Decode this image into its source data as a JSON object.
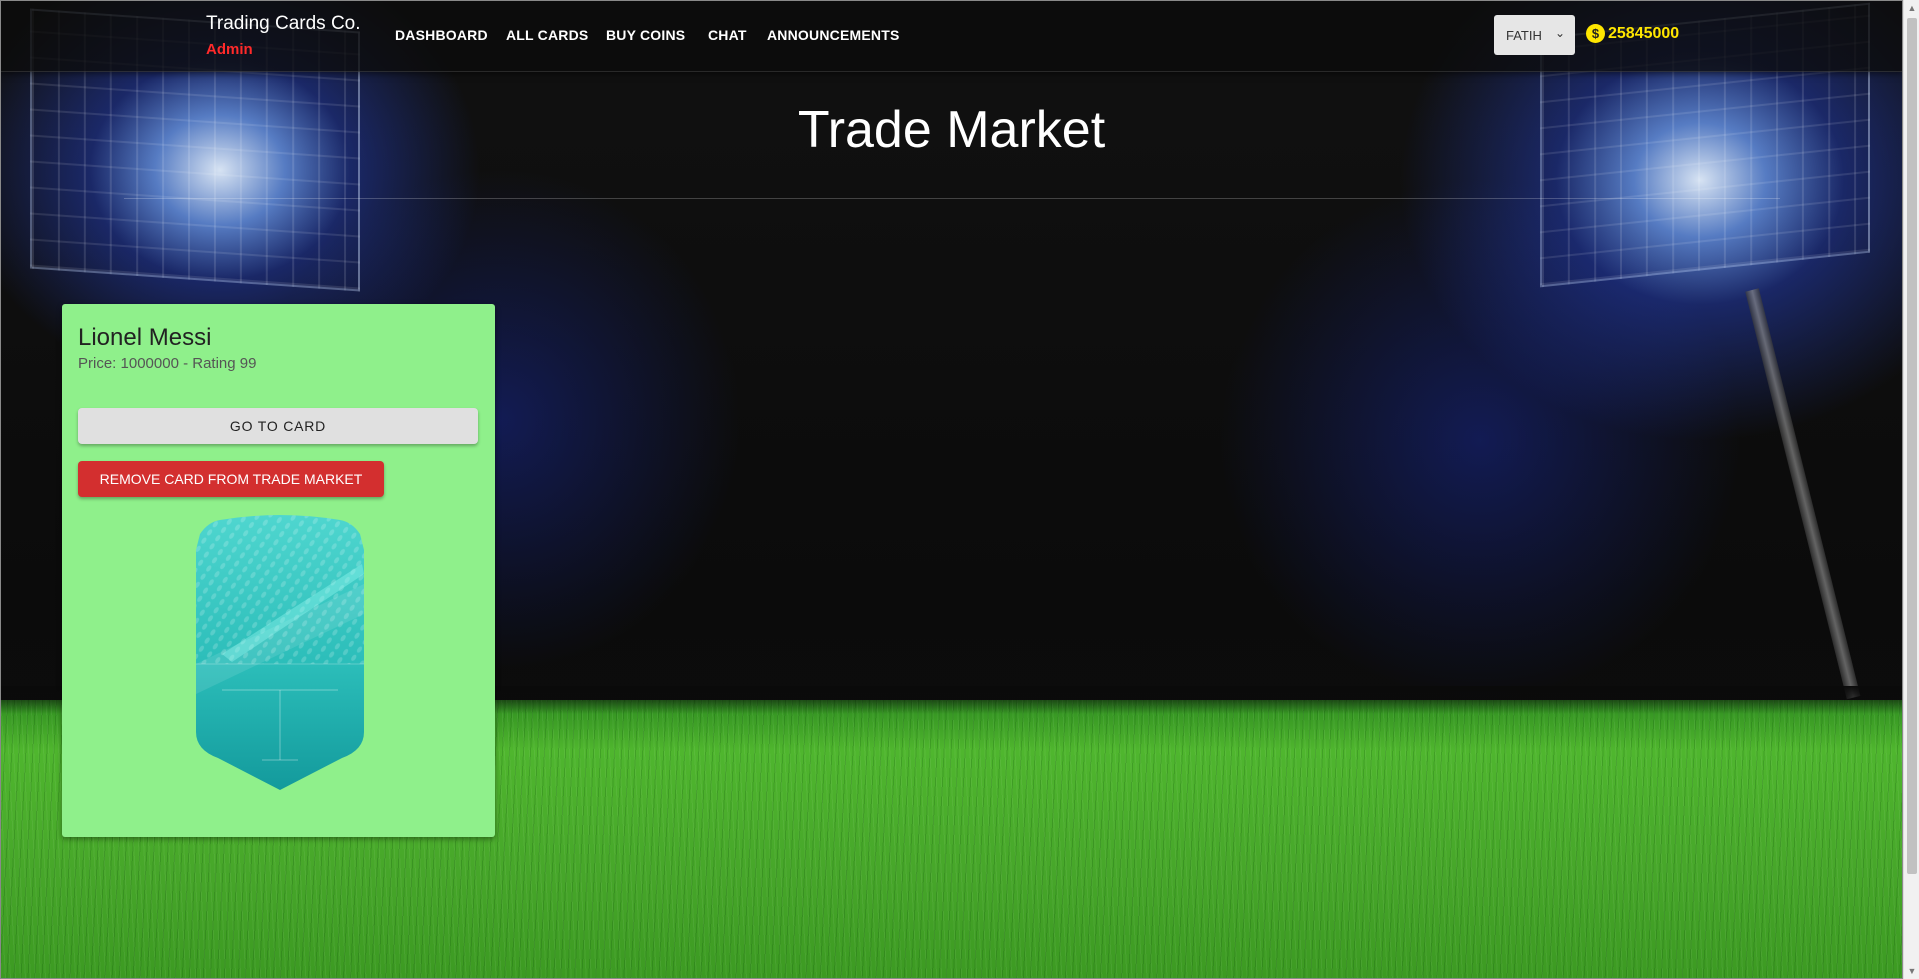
{
  "navbar": {
    "brand_title": "Trading Cards Co.",
    "brand_role": "Admin",
    "links": [
      "DASHBOARD",
      "ALL CARDS",
      "BUY COINS",
      "CHAT",
      "ANNOUNCEMENTS"
    ],
    "user_select": {
      "selected": "FATIH"
    },
    "coins": {
      "icon": "dollar-coin-icon",
      "value": "25845000",
      "color": "#ffe600"
    }
  },
  "main": {
    "title": "Trade Market"
  },
  "card": {
    "name": "Lionel Messi",
    "meta": "Price: 1000000 - Rating 99",
    "go_label": "GO TO CARD",
    "remove_label": "REMOVE CARD FROM TRADE MARKET",
    "background": "#8ff08b"
  },
  "colors": {
    "admin_role": "#ff2a2a",
    "remove_button": "#d32f2f"
  }
}
